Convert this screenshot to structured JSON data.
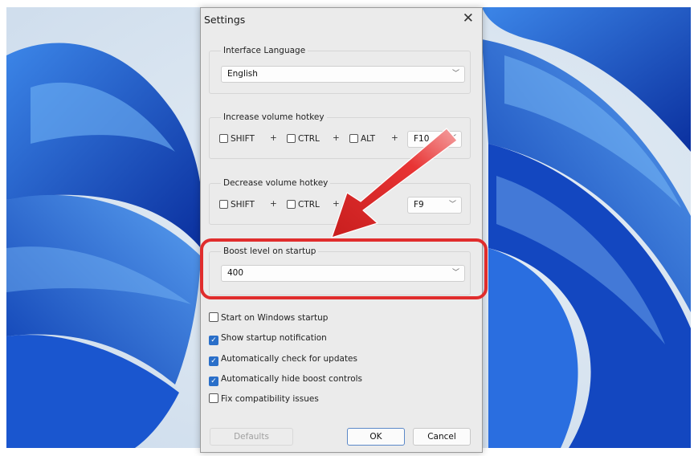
{
  "dialog": {
    "title": "Settings",
    "close_glyph": "✕"
  },
  "interface_language": {
    "legend": "Interface Language",
    "value": "English"
  },
  "increase_hotkey": {
    "legend": "Increase volume hotkey",
    "shift_label": "SHIFT",
    "ctrl_label": "CTRL",
    "alt_label": "ALT",
    "plus": "+",
    "key_value": "F10"
  },
  "decrease_hotkey": {
    "legend": "Decrease volume hotkey",
    "shift_label": "SHIFT",
    "ctrl_label": "CTRL",
    "plus": "+",
    "key_value": "F9"
  },
  "boost": {
    "legend": "Boost level on startup",
    "value": "400"
  },
  "options": [
    {
      "label": "Start on Windows startup",
      "checked": false
    },
    {
      "label": "Show startup notification",
      "checked": true
    },
    {
      "label": "Automatically check for updates",
      "checked": true
    },
    {
      "label": "Automatically hide boost controls",
      "checked": true
    },
    {
      "label": "Fix compatibility issues",
      "checked": false
    }
  ],
  "buttons": {
    "defaults": "Defaults",
    "ok": "OK",
    "cancel": "Cancel"
  },
  "icons": {
    "chevron": "chevron-down-icon",
    "check": "checkmark-icon"
  },
  "colors": {
    "annotation_red": "#e02d2d",
    "check_blue": "#2a6fc9",
    "wallpaper_blue": "#1550c8"
  }
}
